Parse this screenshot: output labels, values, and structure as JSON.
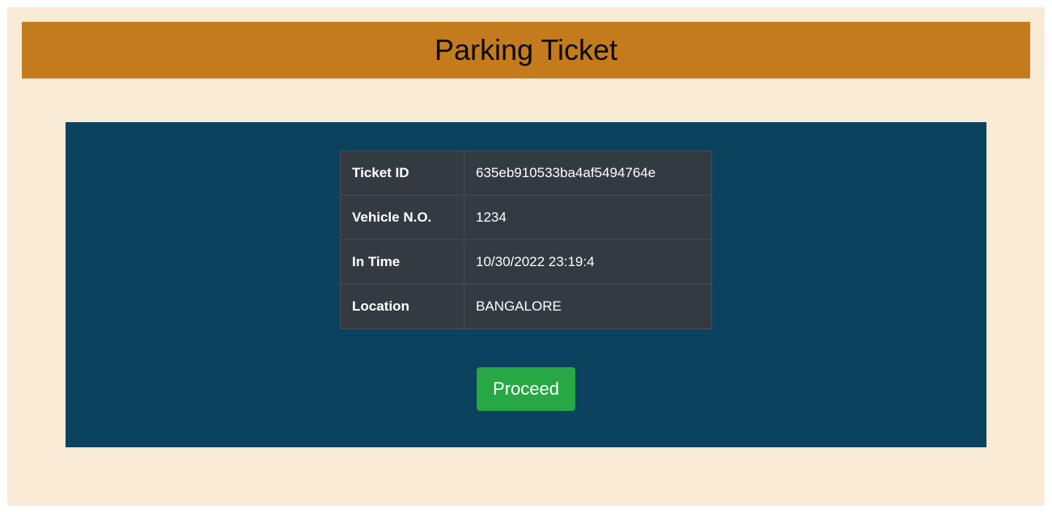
{
  "header": {
    "title": "Parking Ticket"
  },
  "ticket": {
    "rows": [
      {
        "label": "Ticket ID",
        "value": "635eb910533ba4af5494764e"
      },
      {
        "label": "Vehicle N.O.",
        "value": "1234"
      },
      {
        "label": "In Time",
        "value": "10/30/2022 23:19:4"
      },
      {
        "label": "Location",
        "value": "BANGALORE"
      }
    ]
  },
  "actions": {
    "proceed_label": "Proceed"
  },
  "colors": {
    "page_background": "#f9ead6",
    "header_background": "#c47b1d",
    "panel_background": "#0b425e",
    "table_background": "#343a41",
    "button_background": "#28a745"
  }
}
